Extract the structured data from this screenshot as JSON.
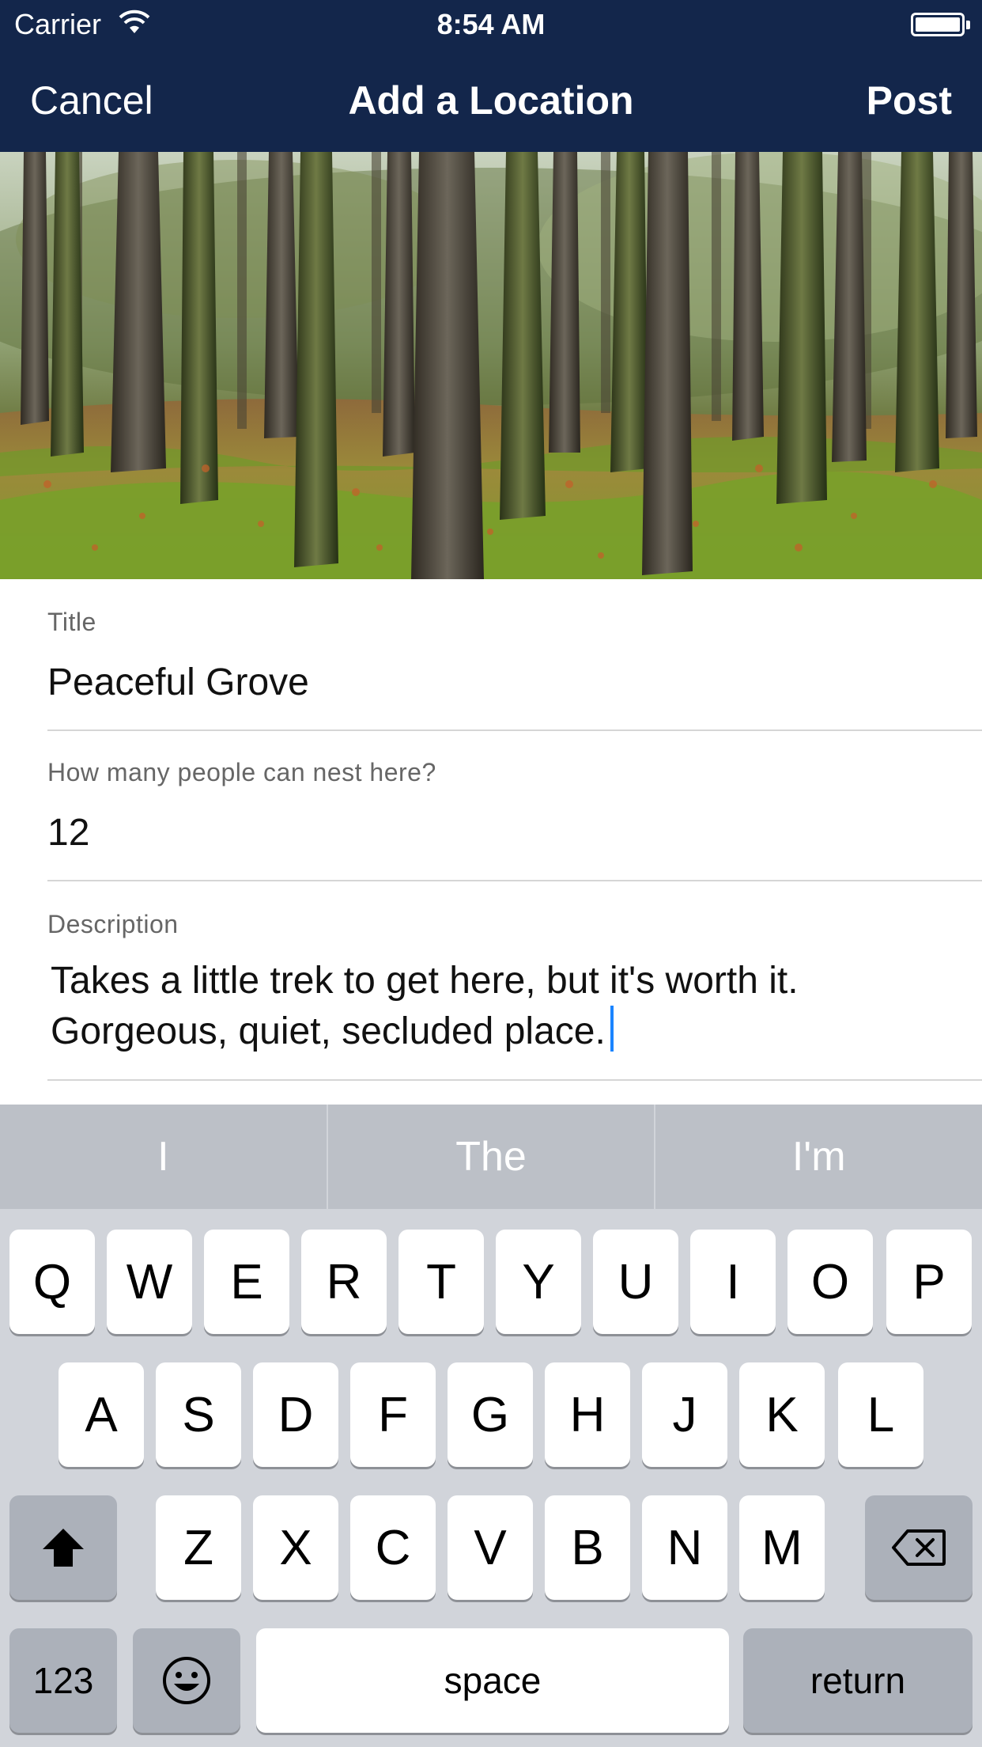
{
  "status_bar": {
    "carrier": "Carrier",
    "time": "8:54 AM"
  },
  "nav": {
    "cancel_label": "Cancel",
    "title": "Add a Location",
    "post_label": "Post"
  },
  "form": {
    "title": {
      "label": "Title",
      "value": "Peaceful Grove"
    },
    "capacity": {
      "label": "How many people can nest here?",
      "value": "12"
    },
    "description": {
      "label": "Description",
      "line1": "Takes a little trek to get here, but it's worth it.",
      "line2": "Gorgeous, quiet, secluded place."
    }
  },
  "keyboard": {
    "suggestions": [
      "I",
      "The",
      "I'm"
    ],
    "row1": [
      "Q",
      "W",
      "E",
      "R",
      "T",
      "Y",
      "U",
      "I",
      "O",
      "P"
    ],
    "row2": [
      "A",
      "S",
      "D",
      "F",
      "G",
      "H",
      "J",
      "K",
      "L"
    ],
    "row3": [
      "Z",
      "X",
      "C",
      "V",
      "B",
      "N",
      "M"
    ],
    "numbers_label": "123",
    "space_label": "space",
    "return_label": "return",
    "shift_icon": "shift-icon",
    "delete_icon": "backspace-icon",
    "emoji_icon": "emoji-icon"
  },
  "colors": {
    "nav_background": "#13264b",
    "caret": "#1a84ff",
    "keyboard_background": "#d1d4da"
  }
}
